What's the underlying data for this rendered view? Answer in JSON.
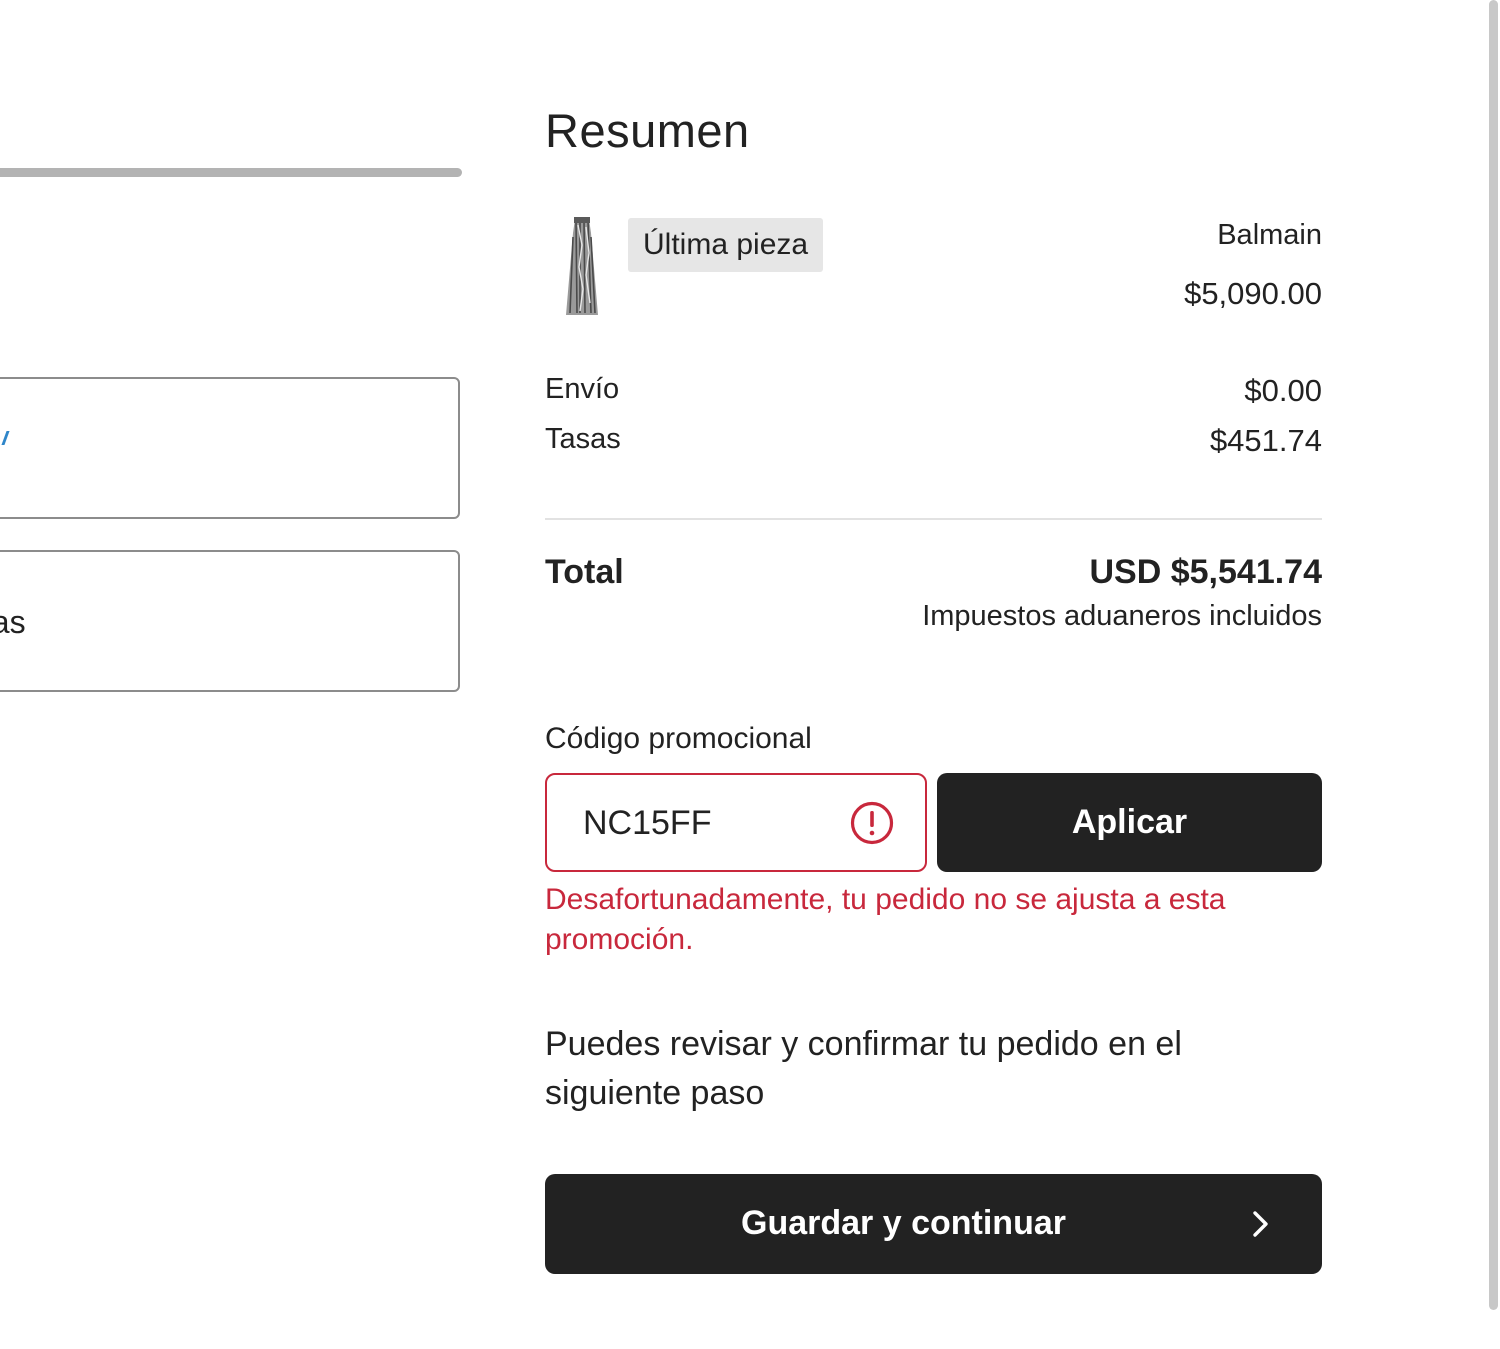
{
  "left_panel": {
    "option_partial_text": "das"
  },
  "summary": {
    "title": "Resumen",
    "item": {
      "badge": "Última pieza",
      "brand": "Balmain",
      "price": "$5,090.00",
      "thumbnail": "skirt-image"
    },
    "shipping": {
      "label": "Envío",
      "value": "$0.00"
    },
    "taxes": {
      "label": "Tasas",
      "value": "$451.74"
    },
    "total": {
      "label": "Total",
      "value": "USD $5,541.74",
      "note": "Impuestos aduaneros incluidos"
    },
    "promo": {
      "label": "Código promocional",
      "value": "NC15FF",
      "status_icon": "alert-circle-icon",
      "apply_label": "Aplicar",
      "error": "Desafortunadamente, tu pedido no se ajusta a esta promoción."
    },
    "info_note": "Puedes revisar y confirmar tu pedido en el siguiente paso",
    "continue_label": "Guardar y continuar",
    "continue_icon": "chevron-right-icon"
  },
  "colors": {
    "error": "#c8283c",
    "button_bg": "#222222",
    "badge_bg": "#e6e6e6",
    "text": "#222222"
  }
}
